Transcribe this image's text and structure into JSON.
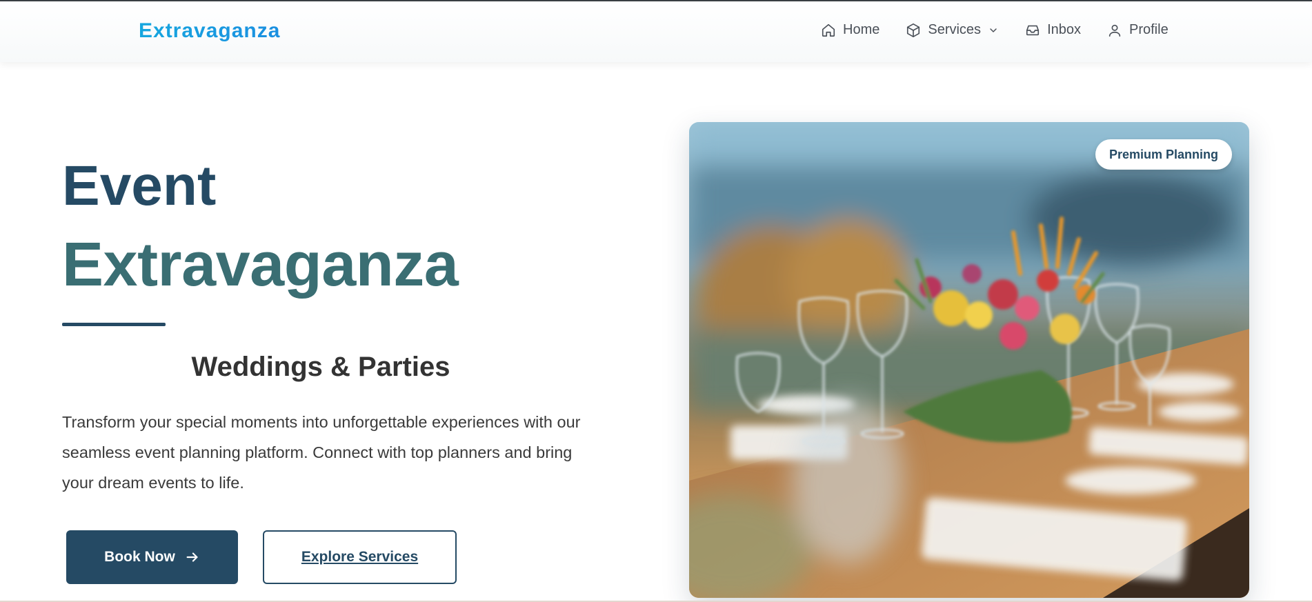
{
  "brand": {
    "name": "Extravaganza"
  },
  "nav": {
    "items": [
      {
        "label": "Home",
        "icon": "home-icon"
      },
      {
        "label": "Services",
        "icon": "box-icon",
        "has_dropdown": true
      },
      {
        "label": "Inbox",
        "icon": "inbox-icon"
      },
      {
        "label": "Profile",
        "icon": "user-icon"
      }
    ]
  },
  "hero": {
    "title_line1": "Event",
    "title_line2": "Extravaganza",
    "subtitle": "Weddings & Parties",
    "description": "Transform your special moments into unforgettable experiences with our seamless event planning platform. Connect with top planners and bring your dream events to life.",
    "primary_button": "Book Now",
    "secondary_button": "Explore Services"
  },
  "photo": {
    "badge": "Premium Planning"
  },
  "colors": {
    "brand_gradient_start": "#16a7df",
    "brand_gradient_end": "#1b8fe0",
    "navy": "#254a64",
    "teal": "#3a6e73"
  }
}
